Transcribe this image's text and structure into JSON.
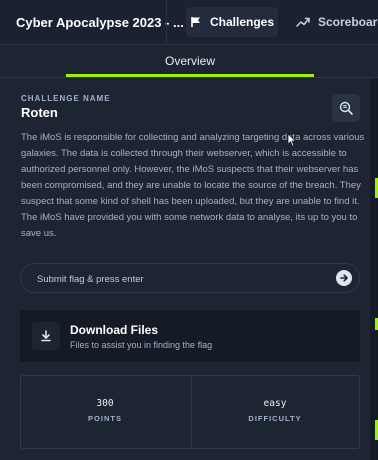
{
  "header": {
    "title": "Cyber Apocalypse 2023 - ...",
    "nav": [
      {
        "label": "Challenges",
        "icon": "flag-icon",
        "active": true
      },
      {
        "label": "Scoreboard",
        "icon": "trending-up-icon",
        "active": false
      }
    ]
  },
  "tabs": {
    "active": "Overview"
  },
  "challenge": {
    "name_label": "CHALLENGE NAME",
    "name": "Roten",
    "description": "The iMoS is responsible for collecting and analyzing targeting data across various galaxies. The data is collected through their webserver, which is accessible to authorized personnel only. However, the iMoS suspects that their webserver has been compromised, and they are unable to locate the source of the breach. They suspect that some kind of shell has been uploaded, but they are unable to find it. The iMoS have provided you with some network data to analyse, its up to you to save us.",
    "hint_icon": "search-document-icon"
  },
  "flag_input": {
    "placeholder": "Submit flag & press enter",
    "value": ""
  },
  "download": {
    "title": "Download Files",
    "subtitle": "Files to assist you in finding the flag"
  },
  "stats": {
    "points_value": "300",
    "points_label": "POINTS",
    "difficulty_value": "easy",
    "difficulty_label": "DIFFICULTY"
  },
  "colors": {
    "accent": "#9fef00",
    "background": "#1d2533",
    "card": "#151b26",
    "muted_text": "#a4b1cd"
  }
}
